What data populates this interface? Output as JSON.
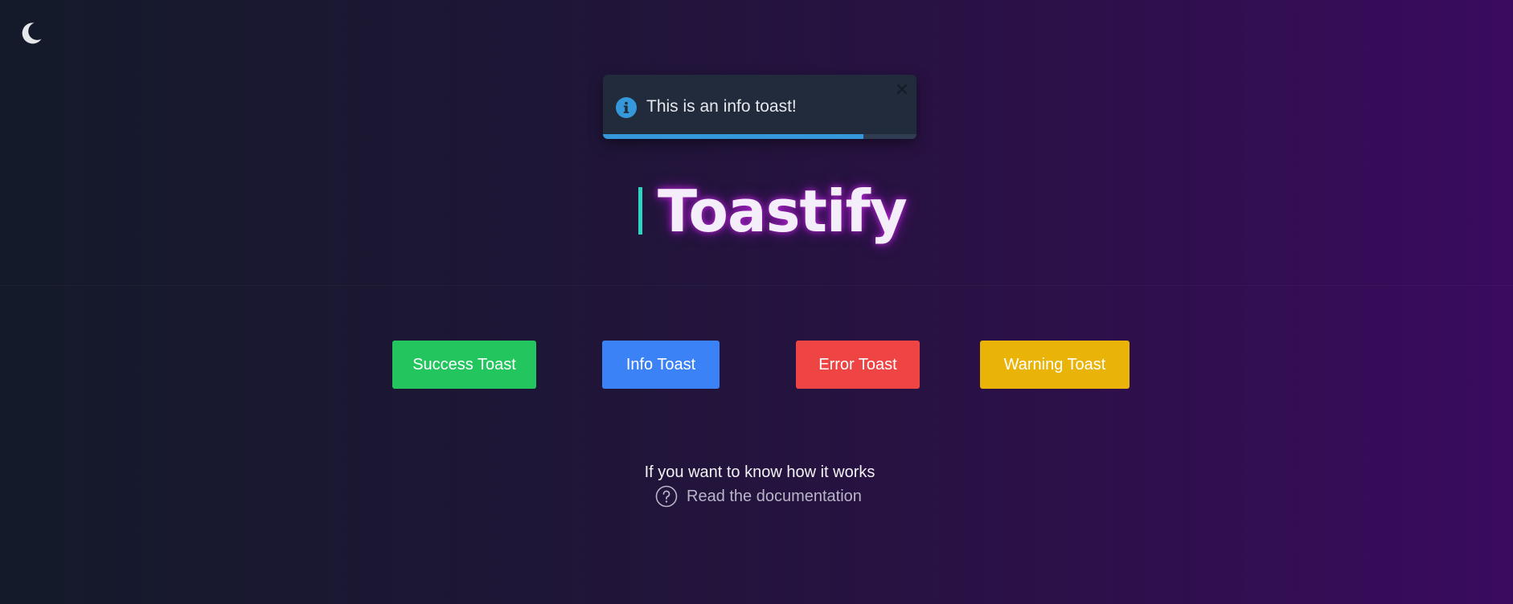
{
  "theme_toggle": {
    "icon": "moon-icon",
    "color": "#e5e7eb"
  },
  "toast": {
    "type": "info",
    "icon": "info-icon",
    "message": "This is an info toast!",
    "close_icon": "close-icon",
    "progress_fraction": 0.83,
    "accent_color": "#3498db",
    "background_color": "#222b3b"
  },
  "title": {
    "text": "Toastify",
    "cursor_color": "#2dd4bf",
    "glow_color": "#c828e6"
  },
  "buttons": [
    {
      "label": "Success Toast",
      "color": "#22c55e"
    },
    {
      "label": "Info Toast",
      "color": "#3b82f6"
    },
    {
      "label": "Error Toast",
      "color": "#ef4444"
    },
    {
      "label": "Warning Toast",
      "color": "#eab308"
    }
  ],
  "footer": {
    "text": "If you want to know how it works",
    "link_icon": "question-circle-icon",
    "link_label": "Read the documentation"
  }
}
